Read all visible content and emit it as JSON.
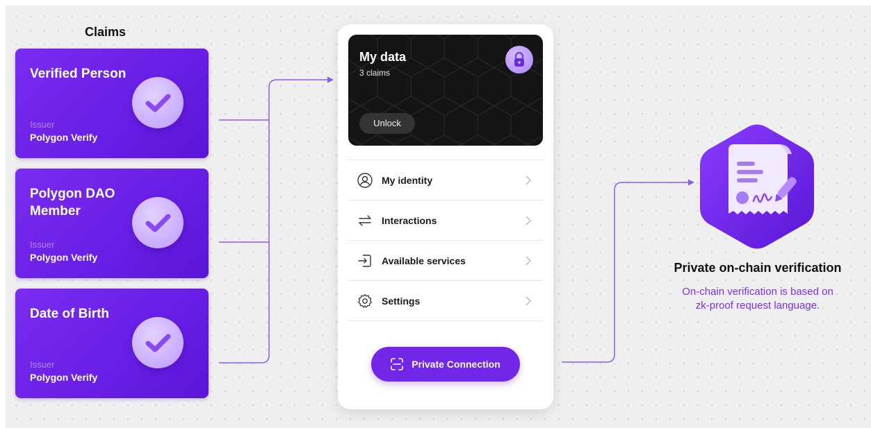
{
  "claims": {
    "title": "Claims",
    "items": [
      {
        "title": "Verified Person",
        "issuer_label": "Issuer",
        "issuer": "Polygon Verify"
      },
      {
        "title": "Polygon DAO Member",
        "issuer_label": "Issuer",
        "issuer": "Polygon Verify"
      },
      {
        "title": "Date of Birth",
        "issuer_label": "Issuer",
        "issuer": "Polygon Verify"
      }
    ]
  },
  "wallet": {
    "data_card": {
      "title": "My data",
      "subtitle": "3 claims",
      "unlock_label": "Unlock",
      "icon": "lock-icon"
    },
    "menu": [
      {
        "label": "My identity",
        "icon": "user-circle-icon"
      },
      {
        "label": "Interactions",
        "icon": "swap-arrows-icon"
      },
      {
        "label": "Available services",
        "icon": "sign-in-icon"
      },
      {
        "label": "Settings",
        "icon": "gear-icon"
      }
    ],
    "connect_button": {
      "label": "Private Connection",
      "icon": "scan-icon"
    }
  },
  "verification": {
    "title": "Private on-chain verification",
    "description_line1": "On-chain verification is based on",
    "description_line2": "zk-proof request language.",
    "icon": "signed-document-icon"
  },
  "colors": {
    "accent": "#7126e8",
    "card_purple": "#6a1fe6",
    "connector": "#8a5cf0",
    "description_text": "#7b2ff0",
    "dark_card": "#141414"
  }
}
